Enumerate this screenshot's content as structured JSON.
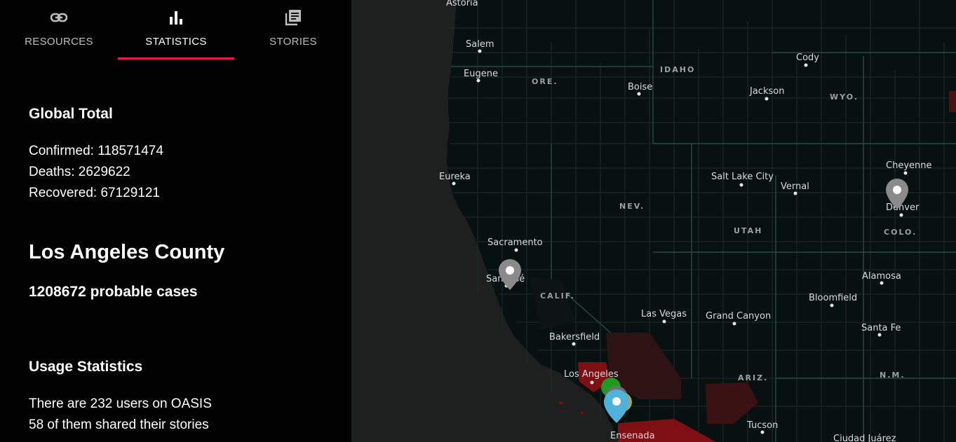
{
  "tabs": [
    {
      "label": "RESOURCES",
      "icon": "link-icon"
    },
    {
      "label": "STATISTICS",
      "icon": "bar-chart-icon"
    },
    {
      "label": "STORIES",
      "icon": "library-books-icon"
    }
  ],
  "active_tab": "STATISTICS",
  "global": {
    "title": "Global Total",
    "confirmed": "Confirmed: 118571474",
    "deaths": "Deaths: 2629622",
    "recovered": "Recovered: 67129121"
  },
  "county": {
    "name": "Los Angeles County",
    "cases": "1208672 probable cases"
  },
  "usage": {
    "title": "Usage Statistics",
    "users": "There are 232 users on OASIS",
    "shared": "58 of them shared their stories"
  },
  "map": {
    "cities": [
      "Astoria",
      "Salem",
      "Eugene",
      "Eureka",
      "Sacramento",
      "San José",
      "Bakersfield",
      "Los Angeles",
      "Ensenada",
      "Boise",
      "Las Vegas",
      "Salt Lake City",
      "Vernal",
      "Jackson",
      "Cody",
      "Cheyenne",
      "Denver",
      "Alamosa",
      "Bloomfield",
      "Santa Fe",
      "Grand Canyon",
      "Tucson",
      "Ciudad Juárez"
    ],
    "states": [
      "IDAHO",
      "ORE.",
      "WYO.",
      "NEV.",
      "UTAH",
      "COLO.",
      "CALIF.",
      "ARIZ.",
      "N.M."
    ],
    "colors": {
      "water": "#1e1f1f",
      "land": "#061110",
      "border": "#233534",
      "high": "#7e0f13",
      "mid": "#2e1314",
      "marker_gray": "#8a8a8a",
      "marker_blue": "#4fb3d9",
      "marker_green": "#1e9a1e"
    }
  }
}
